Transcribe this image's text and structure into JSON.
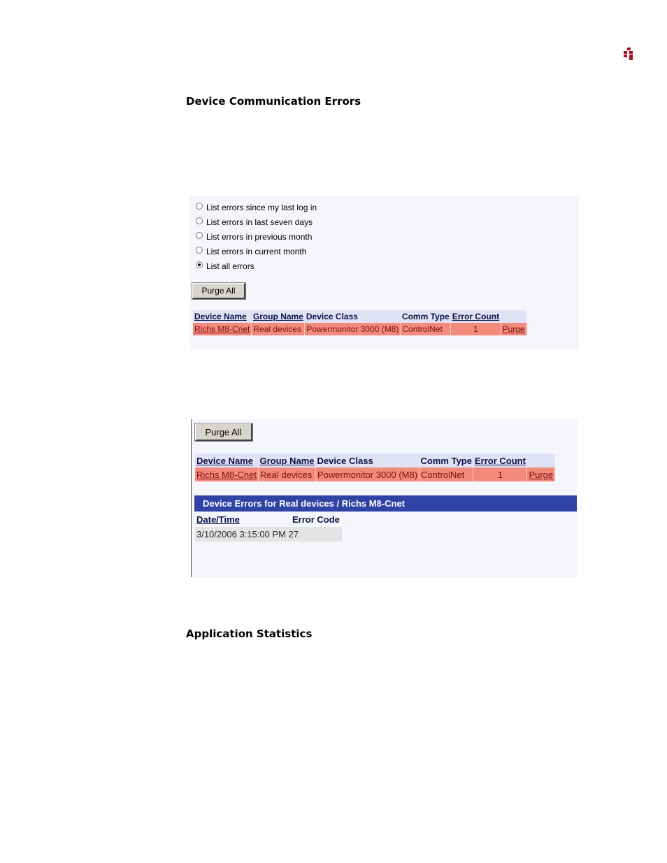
{
  "page": {
    "heading_device_errors": "Device Communication Errors",
    "heading_app_stats": "Application Statistics"
  },
  "logo": {
    "icon": "grid-dots-logo",
    "color": "#b01020"
  },
  "screenshot1": {
    "radio_options": [
      {
        "label": "List errors since my last log in",
        "selected": false
      },
      {
        "label": "List errors in last seven days",
        "selected": false
      },
      {
        "label": "List errors in previous month",
        "selected": false
      },
      {
        "label": "List errors in current month",
        "selected": false
      },
      {
        "label": "List all errors",
        "selected": true
      }
    ],
    "purge_all_label": "Purge All",
    "table": {
      "headers": [
        "Device Name",
        "Group Name",
        "Device Class",
        "Comm Type",
        "Error Count"
      ],
      "rows": [
        {
          "device_name": "Richs M8-Cnet",
          "group_name": "Real devices",
          "device_class": "Powermonitor 3000 (M8)",
          "comm_type": "ControlNet",
          "error_count": "1",
          "action": "Purge"
        }
      ]
    }
  },
  "screenshot2": {
    "purge_all_label": "Purge All",
    "table": {
      "headers": [
        "Device Name",
        "Group Name",
        "Device Class",
        "Comm Type",
        "Error Count"
      ],
      "rows": [
        {
          "device_name": "Richs M8-Cnet",
          "group_name": "Real devices",
          "device_class": "Powermonitor 3000 (M8)",
          "comm_type": "ControlNet",
          "error_count": "1",
          "action": "Purge"
        }
      ]
    },
    "errors_header": "Device Errors for Real devices / Richs M8-Cnet",
    "errors_table": {
      "headers": [
        "Date/Time",
        "Error Code"
      ],
      "rows": [
        {
          "text": "3/10/2006 3:15:00 PM 27"
        }
      ]
    }
  },
  "colors": {
    "header_row": "#e1e2f5",
    "data_row": "#f48a7c",
    "errors_banner": "#2e43a4",
    "panel_bg": "#f5f6fc"
  }
}
